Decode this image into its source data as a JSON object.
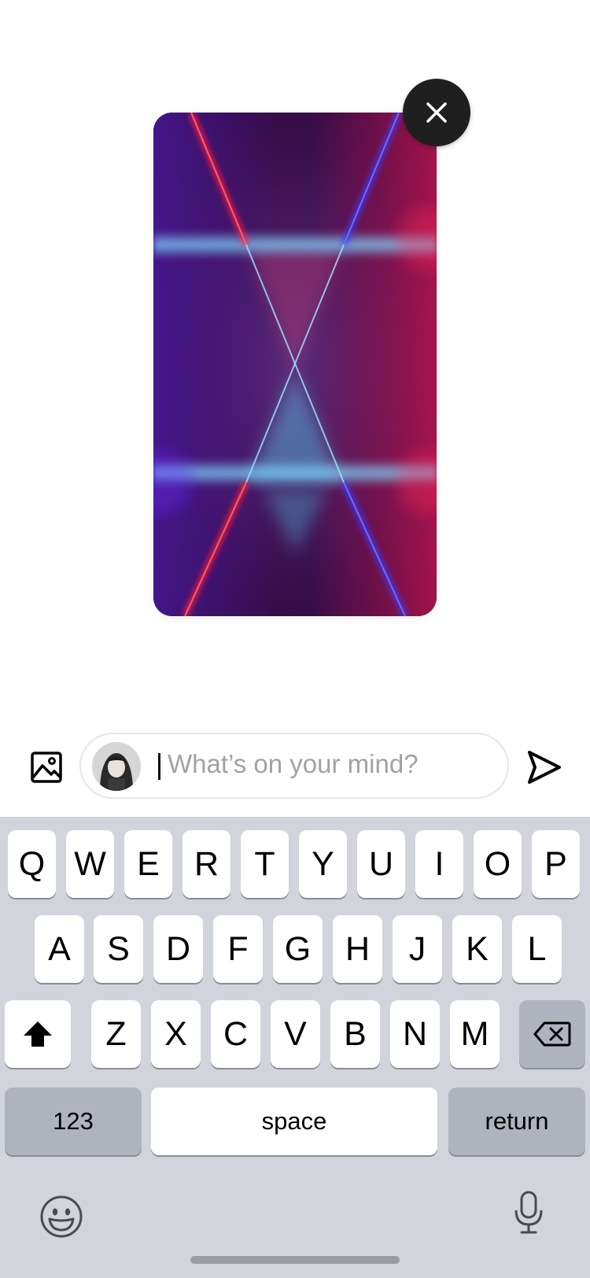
{
  "preview": {
    "image_description_icon": "abstract-neon-image",
    "close_icon": "close-icon"
  },
  "composer": {
    "image_icon": "image-icon",
    "placeholder": "What’s on your mind?",
    "send_icon": "send-icon"
  },
  "keyboard": {
    "row1": [
      "Q",
      "W",
      "E",
      "R",
      "T",
      "Y",
      "U",
      "I",
      "O",
      "P"
    ],
    "row2": [
      "A",
      "S",
      "D",
      "F",
      "G",
      "H",
      "J",
      "K",
      "L"
    ],
    "row3": [
      "Z",
      "X",
      "C",
      "V",
      "B",
      "N",
      "M"
    ],
    "numbers_label": "123",
    "space_label": "space",
    "return_label": "return",
    "shift_icon": "shift-icon",
    "delete_icon": "delete-icon",
    "emoji_icon": "emoji-icon",
    "mic_icon": "microphone-icon"
  },
  "colors": {
    "keyboard_bg": "#d1d4db",
    "key_bg": "#ffffff",
    "special_key_bg": "#aeb3bd",
    "close_button_bg": "#1f1f1f",
    "placeholder_text": "#a1a1a6"
  }
}
